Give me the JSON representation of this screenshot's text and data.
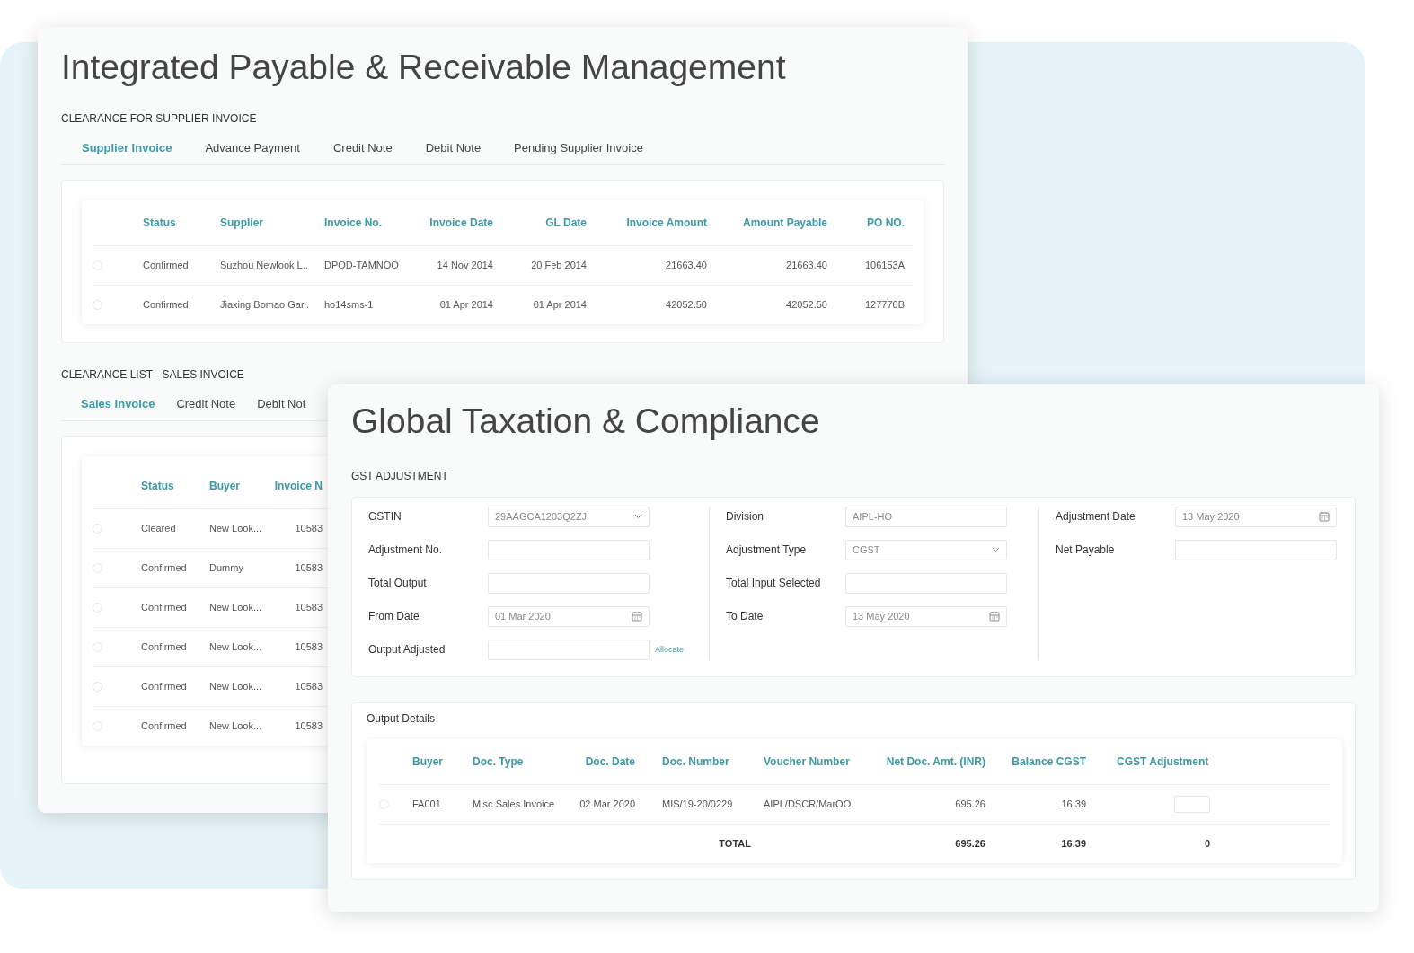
{
  "back_window": {
    "title": "Integrated Payable & Receivable Management",
    "supplier_section": {
      "heading": "CLEARANCE FOR SUPPLIER INVOICE",
      "tabs": [
        {
          "label": "Supplier Invoice",
          "selected": true
        },
        {
          "label": "Advance Payment",
          "selected": false
        },
        {
          "label": "Credit Note",
          "selected": false
        },
        {
          "label": "Debit Note",
          "selected": false
        },
        {
          "label": "Pending Supplier Invoice",
          "selected": false
        }
      ],
      "table": {
        "columns": [
          {
            "label": "Status",
            "kind": "text"
          },
          {
            "label": "Supplier",
            "kind": "text"
          },
          {
            "label": "Invoice No.",
            "kind": "text"
          },
          {
            "label": "Invoice Date",
            "kind": "number"
          },
          {
            "label": "GL Date",
            "kind": "number"
          },
          {
            "label": "Invoice Amount",
            "kind": "number"
          },
          {
            "label": "Amount Payable",
            "kind": "number"
          },
          {
            "label": "PO NO.",
            "kind": "number"
          }
        ],
        "rows": [
          {
            "selected": false,
            "cells": [
              "Confirmed",
              "Suzhou Newlook L..",
              "DPOD-TAMNOO",
              "14 Nov 2014",
              "20 Feb 2014",
              "21663.40",
              "21663.40",
              "106153A"
            ]
          },
          {
            "selected": false,
            "cells": [
              "Confirmed",
              "Jiaxing Bomao Gar..",
              "ho14sms-1",
              "01 Apr 2014",
              "01 Apr 2014",
              "42052.50",
              "42052.50",
              "127770B"
            ]
          }
        ]
      }
    },
    "sales_section": {
      "heading": "CLEARANCE LIST - SALES INVOICE",
      "tabs": [
        {
          "label": "Sales Invoice",
          "selected": true
        },
        {
          "label": "Credit Note",
          "selected": false
        },
        {
          "label": "Debit Not",
          "selected": false
        }
      ],
      "table": {
        "columns": [
          {
            "label": "Status",
            "kind": "text"
          },
          {
            "label": "Buyer",
            "kind": "text"
          },
          {
            "label": "Invoice N",
            "kind": "number"
          }
        ],
        "rows": [
          {
            "selected": false,
            "cells": [
              "Cleared",
              "New Look...",
              "10583"
            ]
          },
          {
            "selected": false,
            "cells": [
              "Confirmed",
              "Dummy",
              "10583"
            ]
          },
          {
            "selected": false,
            "cells": [
              "Confirmed",
              "New Look...",
              "10583"
            ]
          },
          {
            "selected": false,
            "cells": [
              "Confirmed",
              "New Look...",
              "10583"
            ]
          },
          {
            "selected": false,
            "cells": [
              "Confirmed",
              "New Look...",
              "10583"
            ]
          },
          {
            "selected": false,
            "cells": [
              "Confirmed",
              "New Look...",
              "10583"
            ]
          }
        ]
      }
    }
  },
  "front_window": {
    "title": "Global Taxation & Compliance",
    "section_heading": "GST ADJUSTMENT",
    "form": {
      "columns": [
        [
          {
            "label": "GSTIN",
            "kind": "select",
            "value": "29AAGCA1203Q2ZJ"
          },
          {
            "label": "Adjustment No.",
            "kind": "text"
          },
          {
            "label": "Total Output",
            "kind": "text"
          },
          {
            "label": "From Date",
            "kind": "date",
            "value": "01 Mar 2020"
          },
          {
            "label": "Output Adjusted",
            "kind": "text",
            "action": "Allocate"
          }
        ],
        [
          {
            "label": "Division",
            "kind": "text",
            "value": "AIPL-HO"
          },
          {
            "label": "Adjustment Type",
            "kind": "select",
            "value": "CGST"
          },
          {
            "label": "Total Input Selected",
            "kind": "text"
          },
          {
            "label": "To Date",
            "kind": "date",
            "value": "13 May 2020"
          }
        ],
        [
          {
            "label": "Adjustment Date",
            "kind": "date",
            "value": "13 May 2020"
          },
          {
            "label": "Net Payable",
            "kind": "text"
          }
        ]
      ]
    },
    "output_details": {
      "heading": "Output Details",
      "table": {
        "columns": [
          {
            "label": "Buyer",
            "kind": "text"
          },
          {
            "label": "Doc. Type",
            "kind": "text"
          },
          {
            "label": "Doc. Date",
            "kind": "number"
          },
          {
            "label": "Doc. Number",
            "kind": "text"
          },
          {
            "label": "Voucher Number",
            "kind": "text"
          },
          {
            "label": "Net Doc. Amt. (INR)",
            "kind": "number"
          },
          {
            "label": "Balance CGST",
            "kind": "number"
          },
          {
            "label": "CGST Adjustment",
            "kind": "input"
          }
        ],
        "rows": [
          {
            "selected": false,
            "cells": [
              "FA001",
              "Misc Sales Invoice",
              "02 Mar 2020",
              "MIS/19-20/0229",
              "AIPL/DSCR/MarOO.",
              "695.26",
              "16.39"
            ]
          }
        ],
        "total": {
          "label": "TOTAL",
          "values": [
            "695.26",
            "16.39",
            "0"
          ]
        }
      }
    }
  }
}
